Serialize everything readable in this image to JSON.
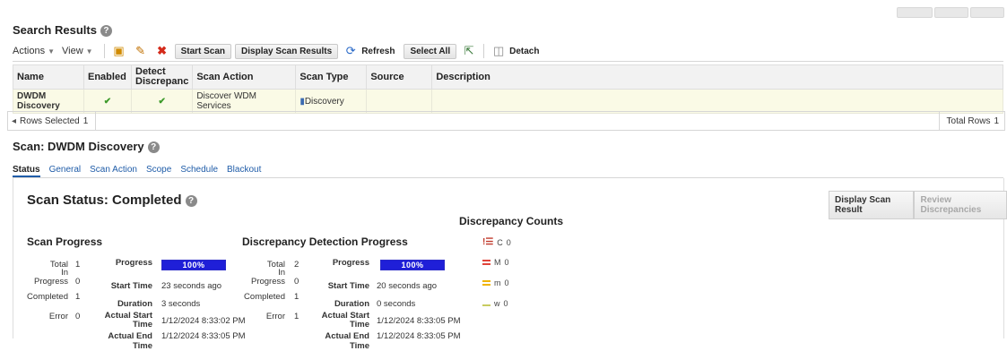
{
  "search": {
    "title": "Search Results",
    "actions_label": "Actions",
    "view_label": "View",
    "start_scan": "Start Scan",
    "display_scan_results": "Display Scan Results",
    "refresh": "Refresh",
    "select_all": "Select All",
    "detach": "Detach",
    "columns": [
      "Name",
      "Enabled",
      "Detect Discrepanc",
      "Scan Action",
      "Scan Type",
      "Source",
      "Description"
    ],
    "row": {
      "name": "DWDM Discovery",
      "scan_action": "Discover WDM Services",
      "scan_type": "Discovery"
    },
    "rows_selected_label": "Rows Selected",
    "rows_selected_value": "1",
    "total_rows_label": "Total Rows",
    "total_rows_value": "1"
  },
  "scan": {
    "title": "Scan: DWDM Discovery",
    "tabs": [
      "Status",
      "General",
      "Scan Action",
      "Scope",
      "Schedule",
      "Blackout"
    ],
    "status_title": "Scan Status: Completed",
    "display_scan_result": "Display Scan Result",
    "review_discrepancies": "Review Discrepancies"
  },
  "progress": {
    "title": "Scan Progress",
    "total_label": "Total",
    "total": "1",
    "in_progress_label": "In Progress",
    "in_progress": "0",
    "completed_label": "Completed",
    "completed": "1",
    "error_label": "Error",
    "error": "0",
    "progress_label": "Progress",
    "progress_value": "100%",
    "progress_fraction": 1.0,
    "start_time_label": "Start Time",
    "start_time": "23 seconds ago",
    "duration_label": "Duration",
    "duration": "3 seconds",
    "actual_start_label": "Actual Start Time",
    "actual_start": "1/12/2024 8:33:02 PM",
    "actual_end_label": "Actual End Time",
    "actual_end": "1/12/2024 8:33:05 PM"
  },
  "detection": {
    "title": "Discrepancy Detection Progress",
    "total_label": "Total",
    "total": "2",
    "in_progress_label": "In Progress",
    "in_progress": "0",
    "completed_label": "Completed",
    "completed": "1",
    "error_label": "Error",
    "error": "1",
    "progress_label": "Progress",
    "progress_value": "100%",
    "progress_fraction": 1.0,
    "start_time_label": "Start Time",
    "start_time": "20 seconds ago",
    "duration_label": "Duration",
    "duration": "0 seconds",
    "actual_start_label": "Actual Start Time",
    "actual_start": "1/12/2024 8:33:05 PM",
    "actual_end_label": "Actual End Time",
    "actual_end": "1/12/2024 8:33:05 PM"
  },
  "counts": {
    "title": "Discrepancy Counts",
    "items": [
      {
        "label": "C",
        "value": "0",
        "color": "#c0392b"
      },
      {
        "label": "M",
        "value": "0",
        "color": "#e0443a"
      },
      {
        "label": "m",
        "value": "0",
        "color": "#f0b400"
      },
      {
        "label": "w",
        "value": "0",
        "color": "#c8cc60"
      }
    ]
  }
}
